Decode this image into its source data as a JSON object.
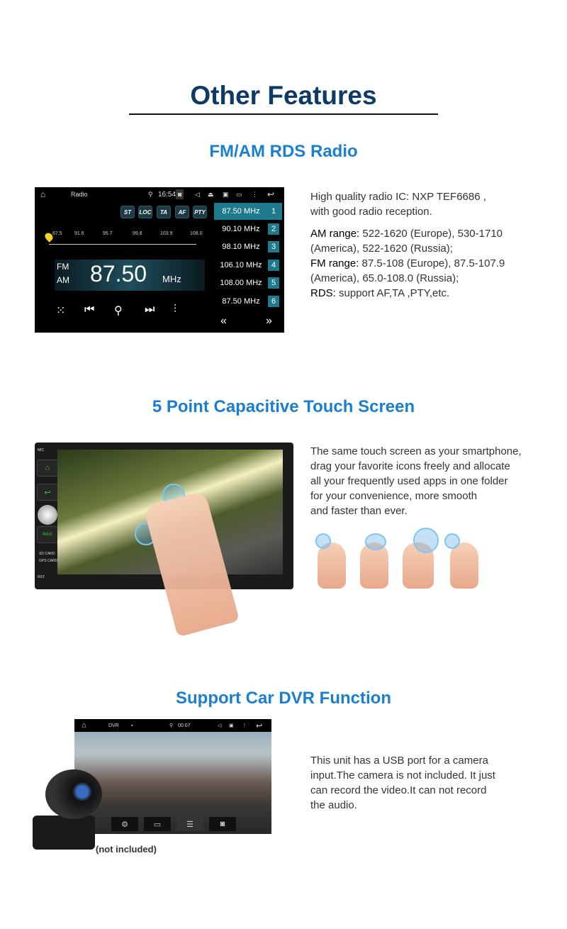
{
  "title": "Other Features",
  "sections": {
    "radio": {
      "heading": "FM/AM RDS Radio",
      "screen": {
        "app_title": "Radio",
        "time": "16:54",
        "toggles": [
          "ST",
          "LOC",
          "TA",
          "AF",
          "PTY"
        ],
        "scale": [
          "87.5",
          "91.6",
          "95.7",
          "99.8",
          "103.9",
          "108.0"
        ],
        "band_fm": "FM",
        "band_am": "AM",
        "frequency": "87.50",
        "unit": "MHz",
        "presets": [
          {
            "freq": "87.50 MHz",
            "num": "1"
          },
          {
            "freq": "90.10 MHz",
            "num": "2"
          },
          {
            "freq": "98.10 MHz",
            "num": "3"
          },
          {
            "freq": "106.10 MHz",
            "num": "4"
          },
          {
            "freq": "108.00 MHz",
            "num": "5"
          },
          {
            "freq": "87.50 MHz",
            "num": "6"
          }
        ],
        "active_preset": 1,
        "accent": "#1e7a8c"
      },
      "desc_line1": "High quality radio IC: NXP TEF6686 ,",
      "desc_line2": "with good radio reception.",
      "am_label": "AM range:",
      "am_text": " 522-1620 (Europe), 530-1710",
      "am_text2": " (America), 522-1620 (Russia);",
      "fm_label": "FM range:",
      "fm_text": " 87.5-108 (Europe), 87.5-107.9",
      "fm_text2": "(America), 65.0-108.0 (Russia);",
      "rds_label": "RDS:",
      "rds_text": " support AF,TA ,PTY,etc."
    },
    "touch": {
      "heading": "5 Point Capacitive Touch Screen",
      "device_buttons": {
        "mic": "MIC",
        "navi": "NAVI",
        "sd": "SD CARD",
        "gps": "GPS CARD",
        "rst": "RST"
      },
      "lines": [
        "The same touch screen as your smartphone,",
        "drag your favorite icons freely and allocate",
        "all your frequently used apps in one folder",
        "for your convenience, more smooth",
        "and faster than ever."
      ]
    },
    "dvr": {
      "heading": "Support Car DVR Function",
      "screen": {
        "app_title": "DVR",
        "time": "00:07"
      },
      "caption": "(not included)",
      "lines": [
        "This unit has a USB port for a camera",
        "input.The camera is not included. It just",
        "can record the video.It can not record",
        "the audio."
      ]
    }
  },
  "colors": {
    "title": "#0d3a66",
    "heading": "#1a7fd0"
  }
}
